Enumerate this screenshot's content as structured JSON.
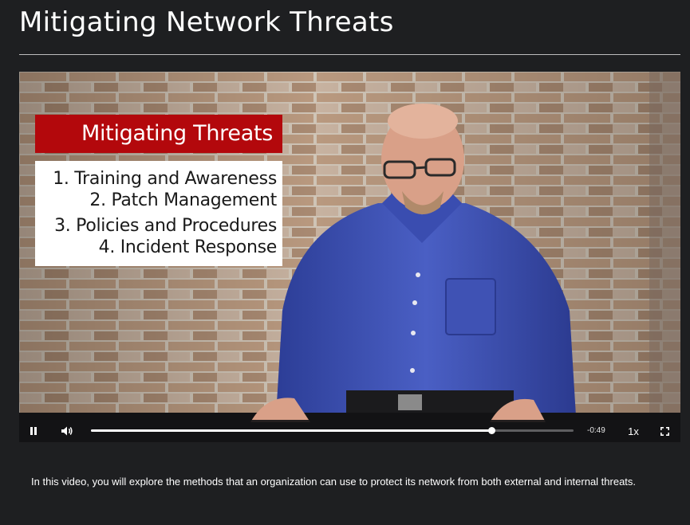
{
  "page": {
    "title": "Mitigating Network Threats"
  },
  "video": {
    "slide": {
      "heading": "Mitigating Threats",
      "items": [
        [
          "1. Training and Awareness",
          "2. Patch Management"
        ],
        [
          "3. Policies and Procedures",
          "4. Incident Response"
        ]
      ]
    },
    "controls": {
      "play_state_icon": "pause-icon",
      "volume_icon": "volume-icon",
      "progress_fraction": 0.83,
      "time_remaining": "-0:49",
      "playback_speed": "1x",
      "fullscreen_icon": "fullscreen-icon"
    }
  },
  "description": "In this video, you will explore the methods that an organization can use to protect its network from both external and internal threats.",
  "colors": {
    "background": "#1e1f21",
    "slide_heading_bg": "#b3080c",
    "shirt_blue": "#3b4fb0"
  }
}
